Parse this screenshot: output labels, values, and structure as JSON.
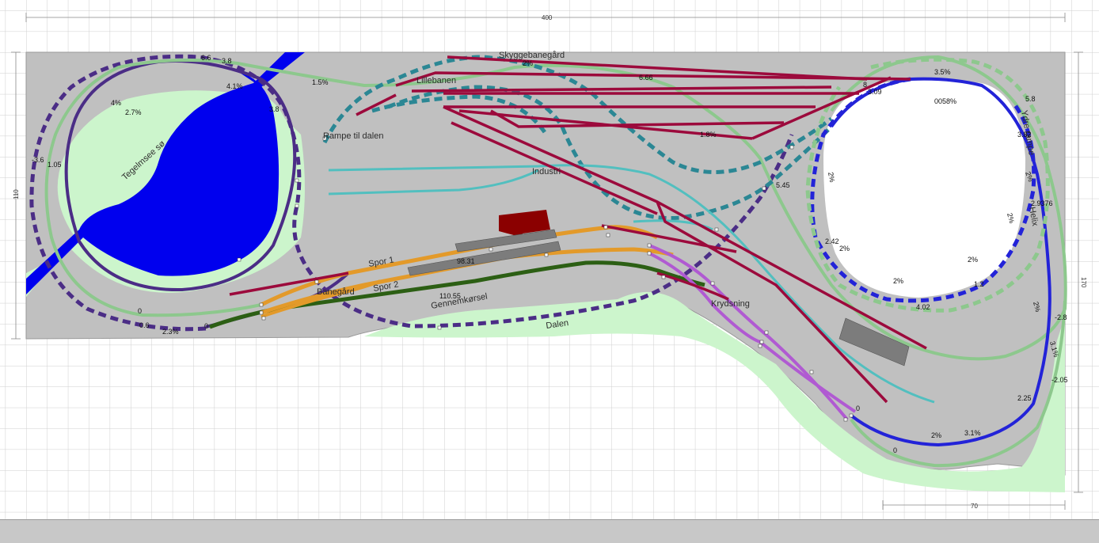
{
  "colors": {
    "background": "#ffffff",
    "grid": "#cfcfcf",
    "board": "#c0c0c0",
    "scenery": "#ccf5cc",
    "lake": "#0000ee",
    "helix_hole": "#ffffff",
    "track_purple": "#4b2d86",
    "track_blue": "#2323d8",
    "track_teal": "#2b8794",
    "track_cyan": "#52bfbf",
    "track_lightgreen": "#8dc88d",
    "track_darkgreen": "#2c5f14",
    "track_orange": "#e39a2a",
    "track_magenta": "#b05ad2",
    "track_red": "#9c0a3c",
    "building": "#8b0000",
    "platform": "#7c7c7c",
    "statusbar": "#c8c8c8"
  },
  "dimensions": {
    "top": "400",
    "left": "110",
    "right": "170",
    "bottom": "70"
  },
  "labels": {
    "tegelmsee": "Tegelmsee sø",
    "rampe": "Rampe til dalen",
    "skyggebanegaard": "Skyggebanegård",
    "lillebanen": "Lillebanen",
    "industri": "Industri",
    "spor1": "Spor 1",
    "spor2": "Spor 2",
    "banegaard": "Banegård",
    "gennemkorsel": "Gennemkørsel",
    "dalen": "Dalen",
    "krydsning": "Krydsning",
    "ydre_rampe": "Ydre rampe",
    "helix": "Helix"
  },
  "grades": {
    "g01": "6.6",
    "g02": "3.8",
    "g03": "4.1%",
    "g04": "1.5%",
    "g05": "4%",
    "g06": "2.7%",
    "g07": "3.8",
    "g08": "-3.6",
    "g09": "1.05",
    "g10": "0",
    "g11": "0.6",
    "g12": "2.3%",
    "g13": "0",
    "g14": "2%",
    "g15": "6.66",
    "g16": "1.8%",
    "g17": "8",
    "g18": "3.09",
    "g19": "3.5%",
    "g20": "5.8",
    "g21": "0058%",
    "g22": "2%",
    "g23": "3.82",
    "g24": "2%",
    "g25": "5.45",
    "g26": "2%",
    "g27": "2.9376",
    "g28": "2.42",
    "g29": "2%",
    "g30": "2%",
    "g31": "2%",
    "g32": "1.2",
    "g33": "4.02",
    "g34": "2%",
    "g35": "-2.8",
    "g36": "3.1%",
    "g37": "-2.05",
    "g38": "2.25",
    "g39": "0",
    "g40": "2%",
    "g41": "3.1%",
    "g42": "0",
    "g43": "110.55",
    "g44": "98.31"
  }
}
